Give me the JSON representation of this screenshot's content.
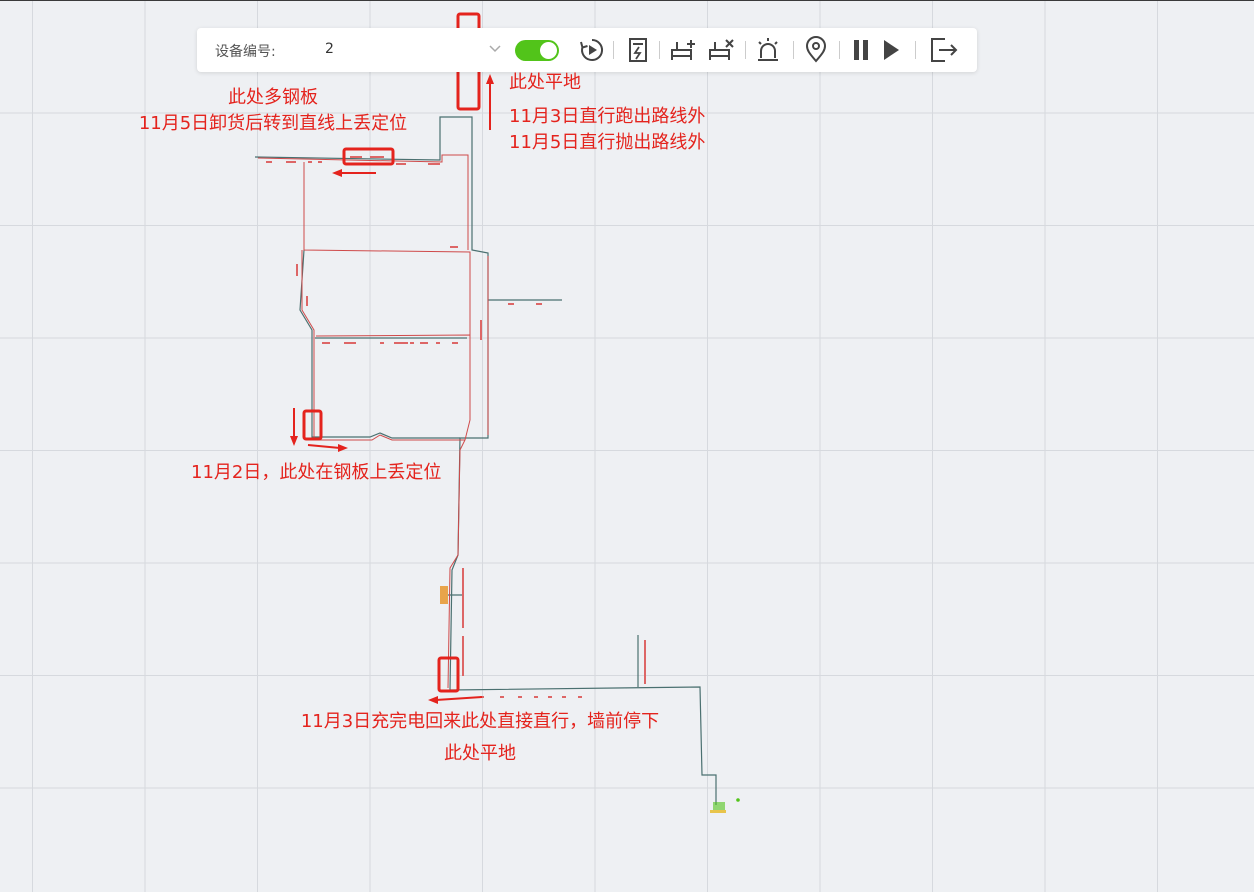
{
  "toolbar": {
    "device_label": "设备编号:",
    "device_value": "2",
    "toggle_on": true,
    "icons": [
      "replay-icon",
      "battery-icon",
      "add-shelf-icon",
      "remove-shelf-icon",
      "alarm-icon",
      "location-icon",
      "pause-icon",
      "play-icon",
      "exit-icon"
    ]
  },
  "annotations": {
    "top_left_1": "此处多钢板",
    "top_left_2": "11月5日卸货后转到直线上丢定位",
    "top_right_1": "此处平地",
    "top_right_2": "11月3日直行跑出路线外",
    "top_right_3": "11月5日直行抛出路线外",
    "mid_left": "11月2日，此处在钢板上丢定位",
    "bottom_1": "11月3日充完电回来此处直接直行，墙前停下",
    "bottom_2": "此处平地"
  },
  "colors": {
    "accent": "#e4231d",
    "toggle": "#52c41a",
    "route": "#cf4a4a",
    "track": "#4a7a7a"
  }
}
